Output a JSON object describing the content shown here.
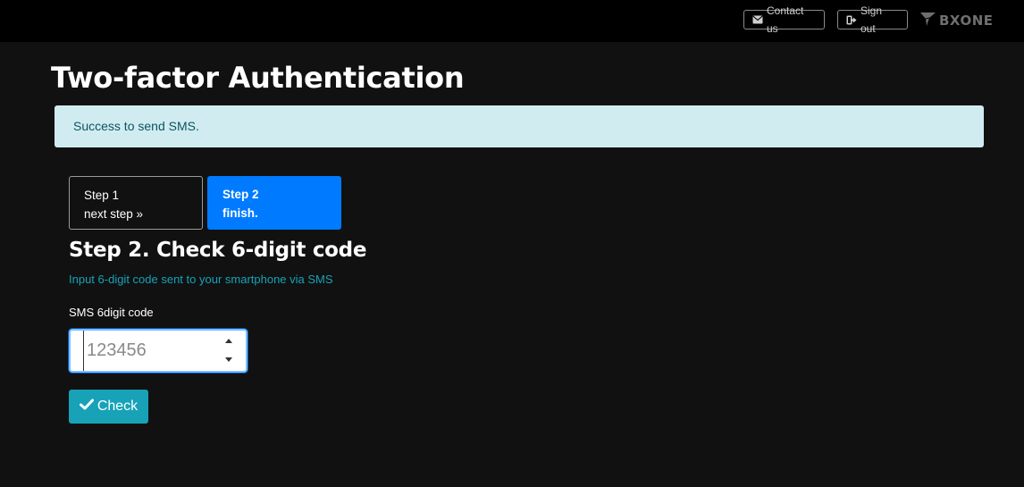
{
  "header": {
    "contact_label": "Contact us",
    "signout_label": "Sign out",
    "logo_text": "BXONE",
    "contact_icon": "envelope-icon",
    "signout_icon": "sign-out-icon"
  },
  "page": {
    "title": "Two-factor Authentication"
  },
  "alert": {
    "message": "Success to send SMS.",
    "bg_color": "#d1ecf1",
    "text_color": "#0c5460"
  },
  "steps": [
    {
      "line1": "Step 1",
      "line2": "next step »",
      "active": false
    },
    {
      "line1": "Step 2",
      "line2": "finish.",
      "active": true,
      "color": "#007bff"
    }
  ],
  "form": {
    "heading": "Step 2. Check 6-digit code",
    "hint": "Input 6-digit code sent to your smartphone via SMS",
    "field_label": "SMS 6digit code",
    "code_placeholder": "123456",
    "code_value": "",
    "submit_label": "Check",
    "submit_icon": "checkmark-icon",
    "submit_color": "#17a2b8"
  }
}
